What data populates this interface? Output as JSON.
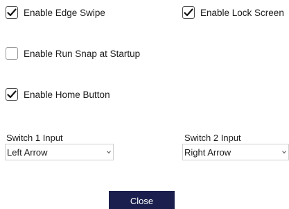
{
  "options": {
    "edge_swipe": {
      "label": "Enable Edge Swipe",
      "checked": true
    },
    "lock_screen": {
      "label": "Enable Lock Screen",
      "checked": true
    },
    "run_snap": {
      "label": "Enable Run Snap at Startup",
      "checked": false
    },
    "home_button": {
      "label": "Enable Home Button",
      "checked": true
    }
  },
  "switch1": {
    "label": "Switch 1 Input",
    "value": "Left Arrow"
  },
  "switch2": {
    "label": "Switch 2 Input",
    "value": "Right Arrow"
  },
  "close_label": "Close",
  "icons": {
    "check": "checkmark-icon",
    "dropdown": "dropdown-arrow-icon"
  }
}
